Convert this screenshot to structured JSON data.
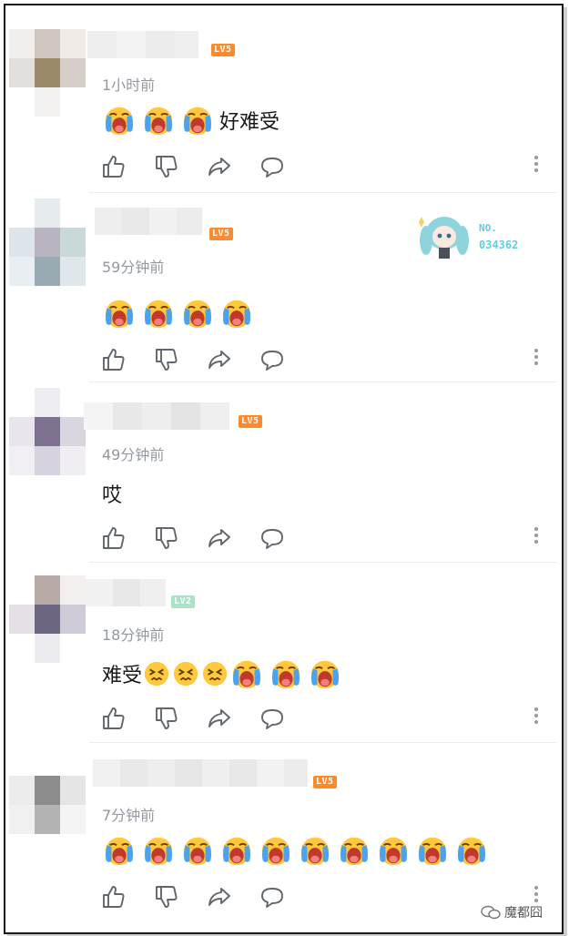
{
  "colors": {
    "time": "#9499a0",
    "lv5": "#ff8a2b",
    "lv2": "#a6e3c7",
    "fan_badge": "#5fcfe0"
  },
  "icons": [
    "like-icon",
    "dislike-icon",
    "share-icon",
    "reply-icon",
    "more-icon",
    "crying-emoji",
    "confounded-emoji"
  ],
  "comments": [
    {
      "level": "LV5",
      "time": "1小时前",
      "text_before": "",
      "text_after": "好难受",
      "crying": 3,
      "confounded": 0
    },
    {
      "level": "LV5",
      "time": "59分钟前",
      "text_before": "",
      "text_after": "",
      "crying": 4,
      "confounded": 0,
      "fan_badge": {
        "label": "NO.",
        "number": "034362"
      }
    },
    {
      "level": "LV5",
      "time": "49分钟前",
      "text_before": "哎",
      "text_after": "",
      "crying": 0,
      "confounded": 0
    },
    {
      "level": "LV2",
      "time": "18分钟前",
      "text_before": "难受",
      "text_after": "",
      "crying": 3,
      "confounded": 3
    },
    {
      "level": "LV5",
      "time": "7分钟前",
      "text_before": "",
      "text_after": "",
      "crying": 10,
      "confounded": 0
    }
  ],
  "watermark": {
    "text": "魔都囧"
  }
}
